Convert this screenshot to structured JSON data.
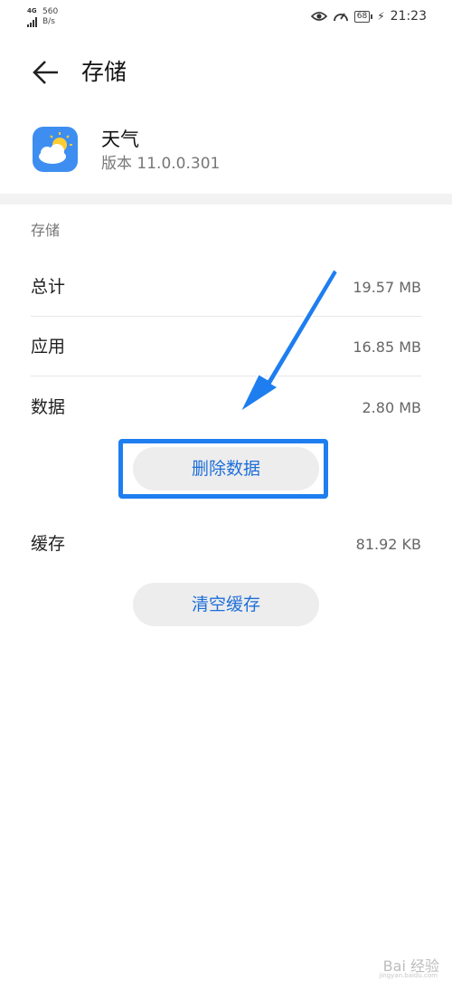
{
  "status_bar": {
    "network": "4G",
    "speed_value": "560",
    "speed_unit": "B/s",
    "battery": "68",
    "time": "21:23"
  },
  "header": {
    "title": "存储"
  },
  "app": {
    "name": "天气",
    "version": "版本 11.0.0.301",
    "icon": "weather-app-icon",
    "icon_color": "#3d8ef0"
  },
  "storage": {
    "section_label": "存储",
    "rows": [
      {
        "label": "总计",
        "value": "19.57 MB"
      },
      {
        "label": "应用",
        "value": "16.85 MB"
      },
      {
        "label": "数据",
        "value": "2.80 MB"
      }
    ],
    "delete_data_label": "删除数据",
    "cache": {
      "label": "缓存",
      "value": "81.92 KB"
    },
    "clear_cache_label": "清空缓存"
  },
  "annotation": {
    "highlight_color": "#1e7ef0",
    "arrow_color": "#1e7ef0"
  },
  "watermark": {
    "text": "Bai 经验",
    "sub": "jingyan.baidu.com"
  }
}
